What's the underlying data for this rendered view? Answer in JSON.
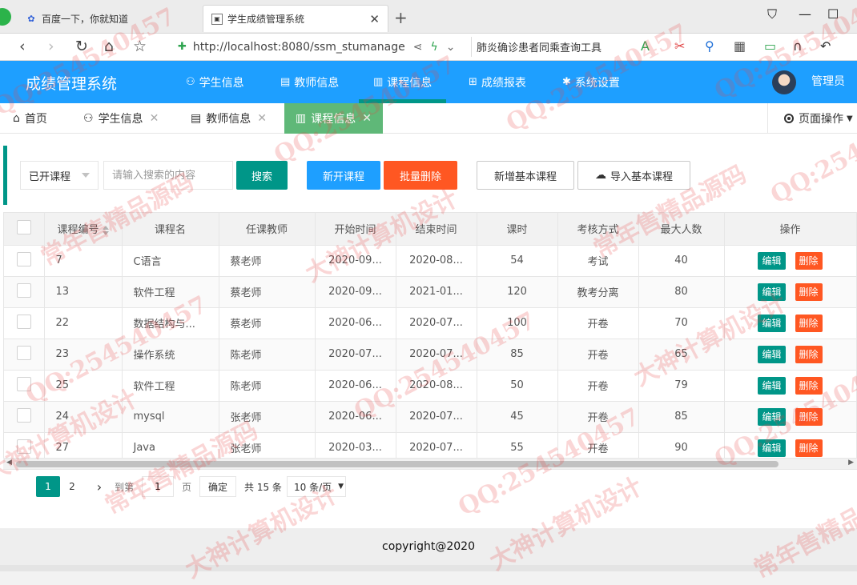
{
  "browser": {
    "tabs": [
      {
        "title": "百度一下，你就知道"
      },
      {
        "title": "学生成绩管理系统"
      }
    ],
    "url": "http://localhost:8080/ssm_stumanage",
    "search_text": "肺炎确诊患者同乘查询工具"
  },
  "app": {
    "brand": "成绩管理系统",
    "menu": [
      {
        "label": "学生信息",
        "icon": "users-icon"
      },
      {
        "label": "教师信息",
        "icon": "clipboard-icon"
      },
      {
        "label": "课程信息",
        "icon": "book-icon"
      },
      {
        "label": "成绩报表",
        "icon": "table-icon"
      },
      {
        "label": "系统设置",
        "icon": "gear-icon"
      }
    ],
    "user": "管理员"
  },
  "page_tabs": [
    {
      "label": "首页",
      "icon": "home-icon"
    },
    {
      "label": "学生信息",
      "icon": "users-icon"
    },
    {
      "label": "教师信息",
      "icon": "clipboard-icon"
    },
    {
      "label": "课程信息",
      "icon": "book-icon"
    }
  ],
  "page_ops": "页面操作",
  "toolbar": {
    "filter_value": "已开课程",
    "search_placeholder": "请输入搜索的内容",
    "search_btn": "搜索",
    "open_course_btn": "新开课程",
    "batch_delete_btn": "批量删除",
    "add_basic_btn": "新增基本课程",
    "import_basic_btn": "导入基本课程"
  },
  "table": {
    "headers": [
      "课程编号",
      "课程名",
      "任课教师",
      "开始时间",
      "结束时间",
      "课时",
      "考核方式",
      "最大人数",
      "操作"
    ],
    "rows": [
      [
        "7",
        "C语言",
        "蔡老师",
        "2020-09...",
        "2020-08...",
        "54",
        "考试",
        "40"
      ],
      [
        "13",
        "软件工程",
        "蔡老师",
        "2020-09...",
        "2021-01...",
        "120",
        "教考分离",
        "80"
      ],
      [
        "22",
        "数据结构与...",
        "蔡老师",
        "2020-06...",
        "2020-07...",
        "100",
        "开卷",
        "70"
      ],
      [
        "23",
        "操作系统",
        "陈老师",
        "2020-07...",
        "2020-07...",
        "85",
        "开卷",
        "65"
      ],
      [
        "25",
        "软件工程",
        "陈老师",
        "2020-06...",
        "2020-08...",
        "50",
        "开卷",
        "79"
      ],
      [
        "24",
        "mysql",
        "张老师",
        "2020-06...",
        "2020-07...",
        "45",
        "开卷",
        "85"
      ],
      [
        "27",
        "Java",
        "张老师",
        "2020-03...",
        "2020-07...",
        "55",
        "开卷",
        "90"
      ]
    ],
    "edit_label": "编辑",
    "delete_label": "删除"
  },
  "pagination": {
    "current": "1",
    "next_page": "2",
    "goto_label": "到第",
    "goto_value": "1",
    "page_unit": "页",
    "confirm": "确定",
    "total": "共 15 条",
    "page_size": "10 条/页"
  },
  "footer": "copyright@2020",
  "watermarks": [
    "QQ:254540457",
    "常年售精品源码",
    "大神计算机设计"
  ]
}
